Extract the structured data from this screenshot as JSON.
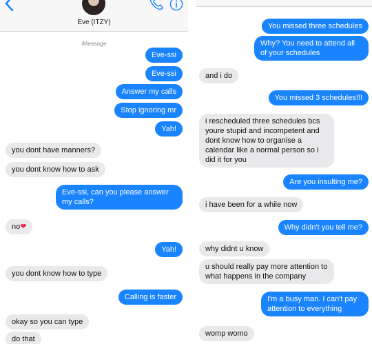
{
  "header": {
    "contact_name": "Eve (ITZY)"
  },
  "service_label": "iMessage",
  "left_messages": [
    {
      "from": "me",
      "text": "Eve-ssi"
    },
    {
      "from": "me",
      "text": "Eve-ssi"
    },
    {
      "from": "me",
      "text": "Answer my calls"
    },
    {
      "from": "me",
      "text": "Stop ignoring mr"
    },
    {
      "from": "me",
      "text": "Yah!"
    },
    {
      "from": "them",
      "text": "you dont have manners?"
    },
    {
      "from": "them",
      "text": "you dont know how to ask"
    },
    {
      "from": "me",
      "text": "Eve-ssi, can you please answer my calls?"
    },
    {
      "from": "them",
      "text": "no",
      "emoji": "❤"
    },
    {
      "from": "me",
      "text": "Yah!"
    },
    {
      "from": "them",
      "text": "you dont know how to type"
    },
    {
      "from": "me",
      "text": "Calling is faster"
    },
    {
      "from": "them",
      "text": "okay so you can type"
    },
    {
      "from": "them",
      "text": "do that"
    }
  ],
  "right_messages": [
    {
      "from": "me",
      "text": "You missed three schedules"
    },
    {
      "from": "me",
      "text": "Why? You need to attend all of your schedules"
    },
    {
      "from": "them",
      "text": "and i do"
    },
    {
      "from": "me",
      "text": "You missed 3 schedules!!!"
    },
    {
      "from": "them",
      "text": "i rescheduled three schedules bcs youre stupid and incompetent and dont know how to organise a calendar like a normal person so i did it for you"
    },
    {
      "from": "me",
      "text": "Are you insulting me?"
    },
    {
      "from": "them",
      "text": "i have been for a while now"
    },
    {
      "from": "me",
      "text": "Why didn't you tell me?"
    },
    {
      "from": "them",
      "text": "why didnt u know"
    },
    {
      "from": "them",
      "text": "u should really pay more attention to what happens in the company"
    },
    {
      "from": "me",
      "text": "I'm a busy man. I can't pay attention to everything"
    },
    {
      "from": "them",
      "text": "womp womo"
    }
  ],
  "colors": {
    "sent_bubble": "#1a84ff",
    "received_bubble": "#e9e9eb",
    "accent": "#1a84ff"
  },
  "icons": [
    "back-chevron-icon",
    "contact-avatar",
    "phone-icon",
    "info-icon"
  ]
}
